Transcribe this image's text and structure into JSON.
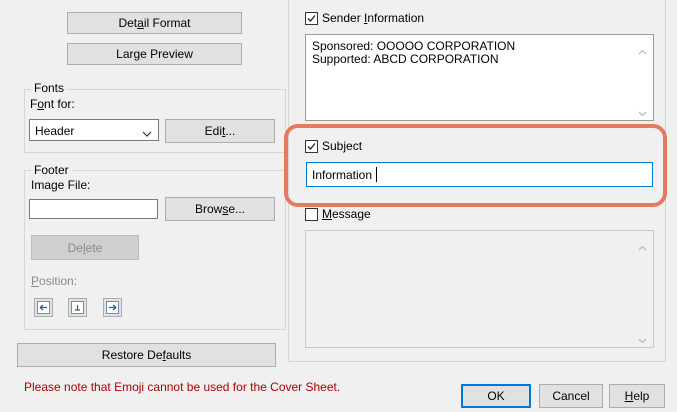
{
  "left_panel": {
    "detail_format_label": "Detail Format",
    "large_preview_label": "Large Preview",
    "fonts": {
      "group_label": "Fonts",
      "font_for_label": "Font for:",
      "font_for_selected": "Header",
      "edit_label": "Edit..."
    },
    "footer": {
      "group_label": "Footer",
      "image_file_label": "Image File:",
      "image_file_value": "",
      "browse_label": "Browse...",
      "delete_label": "Delete",
      "position_label": "Position:",
      "position_buttons": [
        "align-left-icon",
        "align-center-icon",
        "align-right-icon"
      ]
    },
    "restore_defaults_label": "Restore Defaults"
  },
  "right_panel": {
    "sender_information": {
      "label": "Sender Information",
      "checked": true,
      "lines": [
        "Sponsored: OOOOO CORPORATION",
        "Supported: ABCD CORPORATION"
      ]
    },
    "subject": {
      "label": "Subject",
      "checked": true,
      "value": "Information"
    },
    "message": {
      "label": "Message",
      "checked": false,
      "value": ""
    }
  },
  "footer_bar": {
    "note": "Please note that Emoji cannot be used for the Cover Sheet.",
    "note_color": "#b00000",
    "ok_label": "OK",
    "cancel_label": "Cancel",
    "help_label": "Help"
  },
  "highlight_color": "#e57a63"
}
